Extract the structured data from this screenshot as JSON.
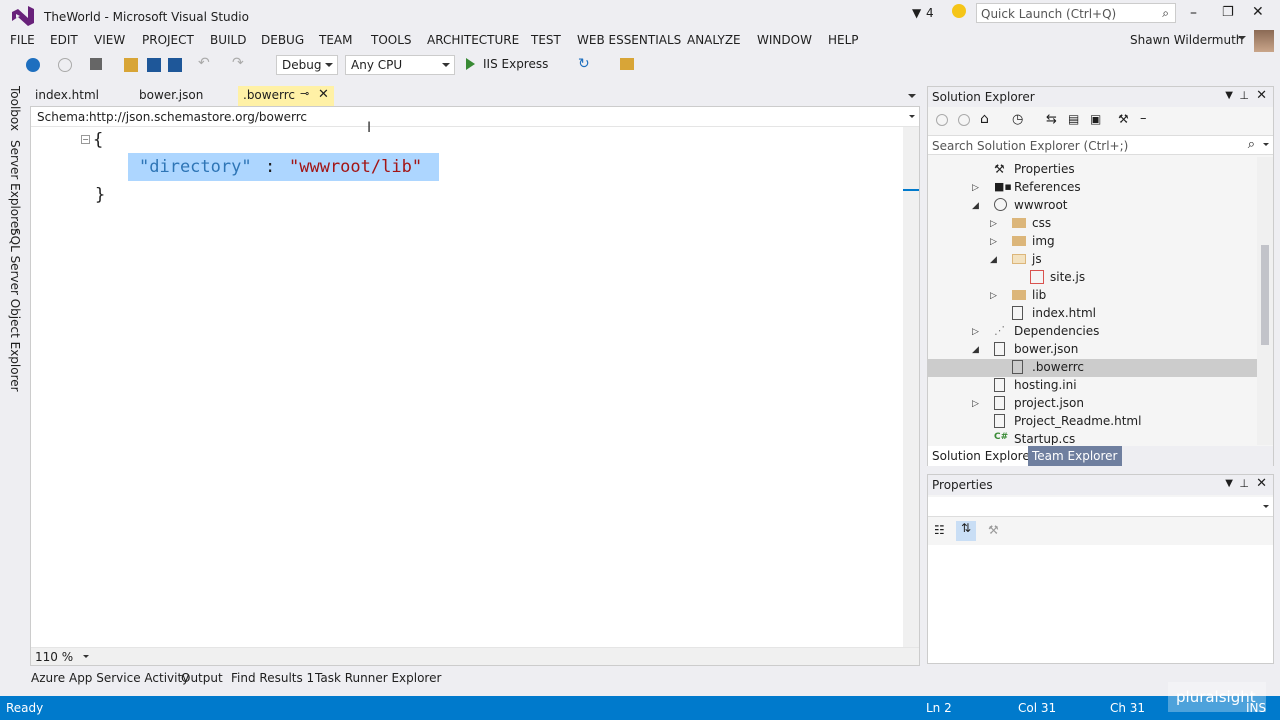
{
  "window": {
    "title": "TheWorld - Microsoft Visual Studio",
    "notification_count": "4",
    "quick_launch_placeholder": "Quick Launch (Ctrl+Q)",
    "user": "Shawn Wildermuth"
  },
  "menu": [
    "FILE",
    "EDIT",
    "VIEW",
    "PROJECT",
    "BUILD",
    "DEBUG",
    "TEAM",
    "TOOLS",
    "ARCHITECTURE",
    "TEST",
    "WEB ESSENTIALS",
    "ANALYZE",
    "WINDOW",
    "HELP"
  ],
  "toolbar": {
    "config": "Debug",
    "platform": "Any CPU",
    "run_target": "IIS Express"
  },
  "left_tool_tabs": [
    "Toolbox",
    "Server Explorer",
    "SQL Server Object Explorer"
  ],
  "editor_tabs": [
    {
      "label": "index.html",
      "active": false
    },
    {
      "label": "bower.json",
      "active": false
    },
    {
      "label": ".bowerrc",
      "active": true
    }
  ],
  "schema": {
    "label": "Schema:",
    "value": "http://json.schemastore.org/bowerrc"
  },
  "code": {
    "open_brace": "{",
    "key": "\"directory\"",
    "colon": ":",
    "value": "\"wwwroot/lib\"",
    "close_brace": "}"
  },
  "zoom": "110 %",
  "solution_explorer": {
    "title": "Solution Explorer",
    "search_placeholder": "Search Solution Explorer (Ctrl+;)",
    "items": [
      {
        "label": "Properties",
        "indent": 0,
        "expander": "",
        "icon": "wrench-icon"
      },
      {
        "label": "References",
        "indent": 0,
        "expander": "▷",
        "icon": "references-icon"
      },
      {
        "label": "wwwroot",
        "indent": 0,
        "expander": "◢",
        "icon": "globe-icon"
      },
      {
        "label": "css",
        "indent": 1,
        "expander": "▷",
        "icon": "folder-icon"
      },
      {
        "label": "img",
        "indent": 1,
        "expander": "▷",
        "icon": "folder-icon"
      },
      {
        "label": "js",
        "indent": 1,
        "expander": "◢",
        "icon": "folder-open-icon"
      },
      {
        "label": "site.js",
        "indent": 2,
        "expander": "",
        "icon": "js-file-icon"
      },
      {
        "label": "lib",
        "indent": 1,
        "expander": "▷",
        "icon": "folder-icon"
      },
      {
        "label": "index.html",
        "indent": 1,
        "expander": "",
        "icon": "html-file-icon"
      },
      {
        "label": "Dependencies",
        "indent": 0,
        "expander": "▷",
        "icon": "dependencies-icon"
      },
      {
        "label": "bower.json",
        "indent": 0,
        "expander": "◢",
        "icon": "json-file-icon"
      },
      {
        "label": ".bowerrc",
        "indent": 1,
        "expander": "",
        "icon": "config-file-icon",
        "selected": true
      },
      {
        "label": "hosting.ini",
        "indent": 0,
        "expander": "",
        "icon": "ini-file-icon"
      },
      {
        "label": "project.json",
        "indent": 0,
        "expander": "▷",
        "icon": "json-file-icon"
      },
      {
        "label": "Project_Readme.html",
        "indent": 0,
        "expander": "",
        "icon": "html-file-icon"
      },
      {
        "label": "Startup.cs",
        "indent": 0,
        "expander": "",
        "icon": "cs-file-icon"
      }
    ],
    "bottom_tabs": [
      "Solution Explorer",
      "Team Explorer"
    ]
  },
  "properties": {
    "title": "Properties"
  },
  "bottom_tabs": [
    "Azure App Service Activity",
    "Output",
    "Find Results 1",
    "Task Runner Explorer"
  ],
  "status": {
    "ready": "Ready",
    "ln": "Ln 2",
    "col": "Col 31",
    "ch": "Ch 31",
    "mode": "INS",
    "watermark": "pluralsight"
  },
  "colors": {
    "accent": "#007acc",
    "selection": "#add6ff",
    "key": "#2e75b6",
    "string": "#a31515"
  }
}
